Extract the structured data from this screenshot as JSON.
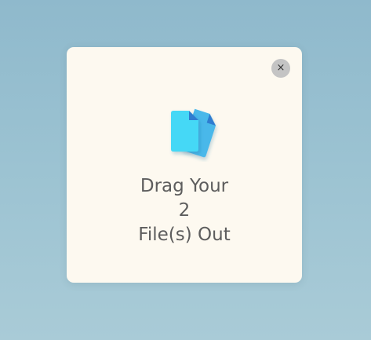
{
  "dialog": {
    "close_label": "×",
    "icon": "files-icon",
    "message": {
      "line1": "Drag Your",
      "count": "2",
      "line3": "File(s) Out"
    }
  },
  "colors": {
    "card_background": "#fdf9f0",
    "file_front": "#45d8f6",
    "file_back": "#4ab8ea",
    "file_fold": "#2e7cd0",
    "text": "#5d5d5d",
    "close_button": "#c4c4c4"
  }
}
